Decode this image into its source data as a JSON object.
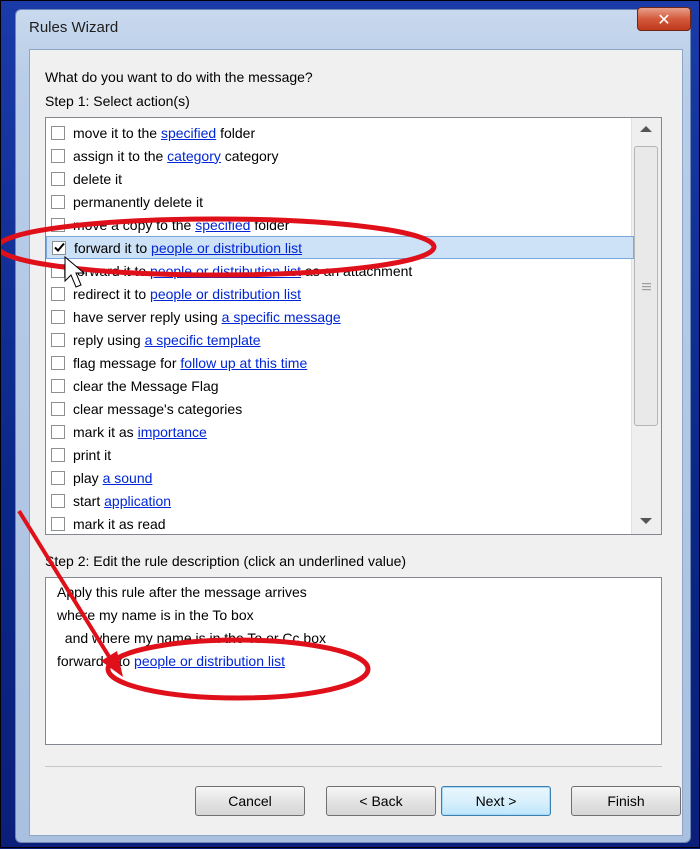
{
  "window": {
    "title": "Rules Wizard",
    "close_glyph": "✕"
  },
  "step1": {
    "question": "What do you want to do with the message?",
    "label": "Step 1: Select action(s)",
    "actions": [
      {
        "pre": "move it to the ",
        "link": "specified",
        "post": " folder",
        "checked": false
      },
      {
        "pre": "assign it to the ",
        "link": "category",
        "post": " category",
        "checked": false
      },
      {
        "pre": "delete it",
        "link": "",
        "post": "",
        "checked": false
      },
      {
        "pre": "permanently delete it",
        "link": "",
        "post": "",
        "checked": false
      },
      {
        "pre": "move a copy to the ",
        "link": "specified",
        "post": " folder",
        "checked": false
      },
      {
        "pre": "forward it to ",
        "link": "people or distribution list",
        "post": "",
        "checked": true
      },
      {
        "pre": "forward it to ",
        "link": "people or distribution list",
        "post": " as an attachment",
        "checked": false
      },
      {
        "pre": "redirect it to ",
        "link": "people or distribution list",
        "post": "",
        "checked": false
      },
      {
        "pre": "have server reply using ",
        "link": "a specific message",
        "post": "",
        "checked": false
      },
      {
        "pre": "reply using ",
        "link": "a specific template",
        "post": "",
        "checked": false
      },
      {
        "pre": "flag message for ",
        "link": "follow up at this time",
        "post": "",
        "checked": false
      },
      {
        "pre": "clear the Message Flag",
        "link": "",
        "post": "",
        "checked": false
      },
      {
        "pre": "clear message's categories",
        "link": "",
        "post": "",
        "checked": false
      },
      {
        "pre": "mark it as ",
        "link": "importance",
        "post": "",
        "checked": false
      },
      {
        "pre": "print it",
        "link": "",
        "post": "",
        "checked": false
      },
      {
        "pre": "play ",
        "link": "a sound",
        "post": "",
        "checked": false
      },
      {
        "pre": "start ",
        "link": "application",
        "post": "",
        "checked": false
      },
      {
        "pre": "mark it as read",
        "link": "",
        "post": "",
        "checked": false
      }
    ],
    "selected_index": 5
  },
  "step2": {
    "label": "Step 2: Edit the rule description (click an underlined value)",
    "lines": [
      {
        "pre": "Apply this rule after the message arrives",
        "link": ""
      },
      {
        "pre": "where my name is in the To box",
        "link": ""
      },
      {
        "pre": "  and where my name is in the To or Cc box",
        "link": ""
      },
      {
        "pre": "forward it to ",
        "link": "people or distribution list"
      }
    ]
  },
  "buttons": {
    "cancel": "Cancel",
    "back": "< Back",
    "next": "Next >",
    "finish": "Finish"
  },
  "colors": {
    "link": "#0026d6",
    "annotation": "#e0101a",
    "selection": "#cde1f7"
  }
}
